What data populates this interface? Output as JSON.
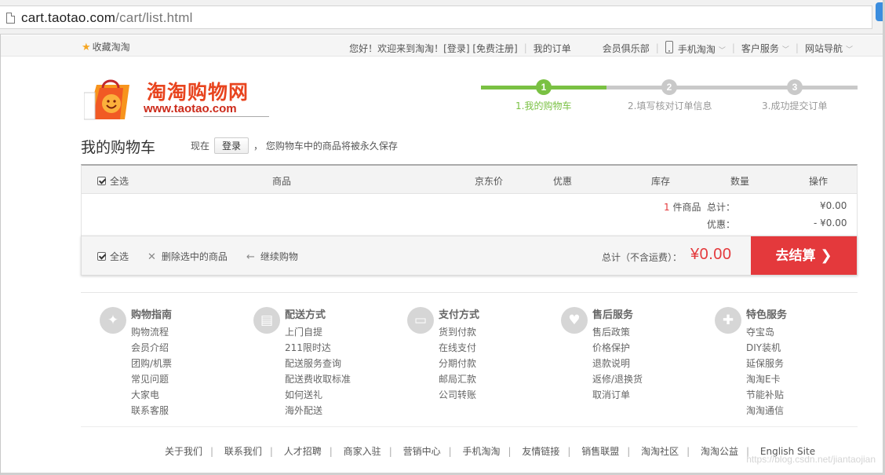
{
  "address_bar": {
    "url_host": "cart.taotao.com",
    "url_path": "/cart/list.html"
  },
  "topnav": {
    "favorite": "收藏淘淘",
    "welcome": "您好！欢迎来到淘淘！[登录] [免费注册]",
    "my_orders": "我的订单",
    "member_club": "会员俱乐部",
    "mobile": "手机淘淘",
    "customer_service": "客户服务",
    "site_nav": "网站导航"
  },
  "logo": {
    "name_cn": "淘淘购物网",
    "name_en": "www.taotao.com"
  },
  "steps": [
    {
      "num": "1",
      "label": "1.我的购物车"
    },
    {
      "num": "2",
      "label": "2.填写核对订单信息"
    },
    {
      "num": "3",
      "label": "3.成功提交订单"
    }
  ],
  "progress_current_step": 1,
  "cart": {
    "title": "我的购物车",
    "hint_prefix": "现在",
    "login_button": "登录",
    "hint_suffix": "，  您购物车中的商品将被永久保存"
  },
  "table_header": {
    "select_all": "全选",
    "product": "商品",
    "price": "京东价",
    "discount": "优惠",
    "stock": "库存",
    "quantity": "数量",
    "action": "操作"
  },
  "summary": {
    "count": "1",
    "count_unit": "件商品",
    "total_label": "总计：",
    "total_value": "¥0.00",
    "discount_label": "优惠：",
    "discount_value": "- ¥0.00"
  },
  "bottom_bar": {
    "select_all": "全选",
    "delete_selected": "删除选中的商品",
    "continue_shopping": "继续购物",
    "total_label": "总计（不含运费）：",
    "total_value": "¥0.00",
    "checkout": "去结算"
  },
  "services": [
    {
      "icon": "compass-icon",
      "glyph": "✦",
      "title": "购物指南",
      "items": [
        "购物流程",
        "会员介绍",
        "团购/机票",
        "常见问题",
        "大家电",
        "联系客服"
      ]
    },
    {
      "icon": "truck-icon",
      "glyph": "▤",
      "title": "配送方式",
      "items": [
        "上门自提",
        "211限时达",
        "配送服务查询",
        "配送费收取标准",
        "如何送礼",
        "海外配送"
      ]
    },
    {
      "icon": "wallet-icon",
      "glyph": "▭",
      "title": "支付方式",
      "items": [
        "货到付款",
        "在线支付",
        "分期付款",
        "邮局汇款",
        "公司转账"
      ]
    },
    {
      "icon": "heart-icon",
      "glyph": "♥",
      "title": "售后服务",
      "items": [
        "售后政策",
        "价格保护",
        "退款说明",
        "返修/退换货",
        "取消订单"
      ]
    },
    {
      "icon": "wrench-icon",
      "glyph": "✚",
      "title": "特色服务",
      "items": [
        "夺宝岛",
        "DIY装机",
        "延保服务",
        "淘淘E卡",
        "节能补贴",
        "淘淘通信"
      ]
    }
  ],
  "footer_links": [
    "关于我们",
    "联系我们",
    "人才招聘",
    "商家入驻",
    "营销中心",
    "手机淘淘",
    "友情链接",
    "销售联盟",
    "淘淘社区",
    "淘淘公益",
    "English Site"
  ],
  "watermark": "https://blog.csdn.net/jiantaojian",
  "colors": {
    "accent_red": "#e4393c",
    "step_green": "#7ac143",
    "logo_orange": "#e8441e"
  }
}
